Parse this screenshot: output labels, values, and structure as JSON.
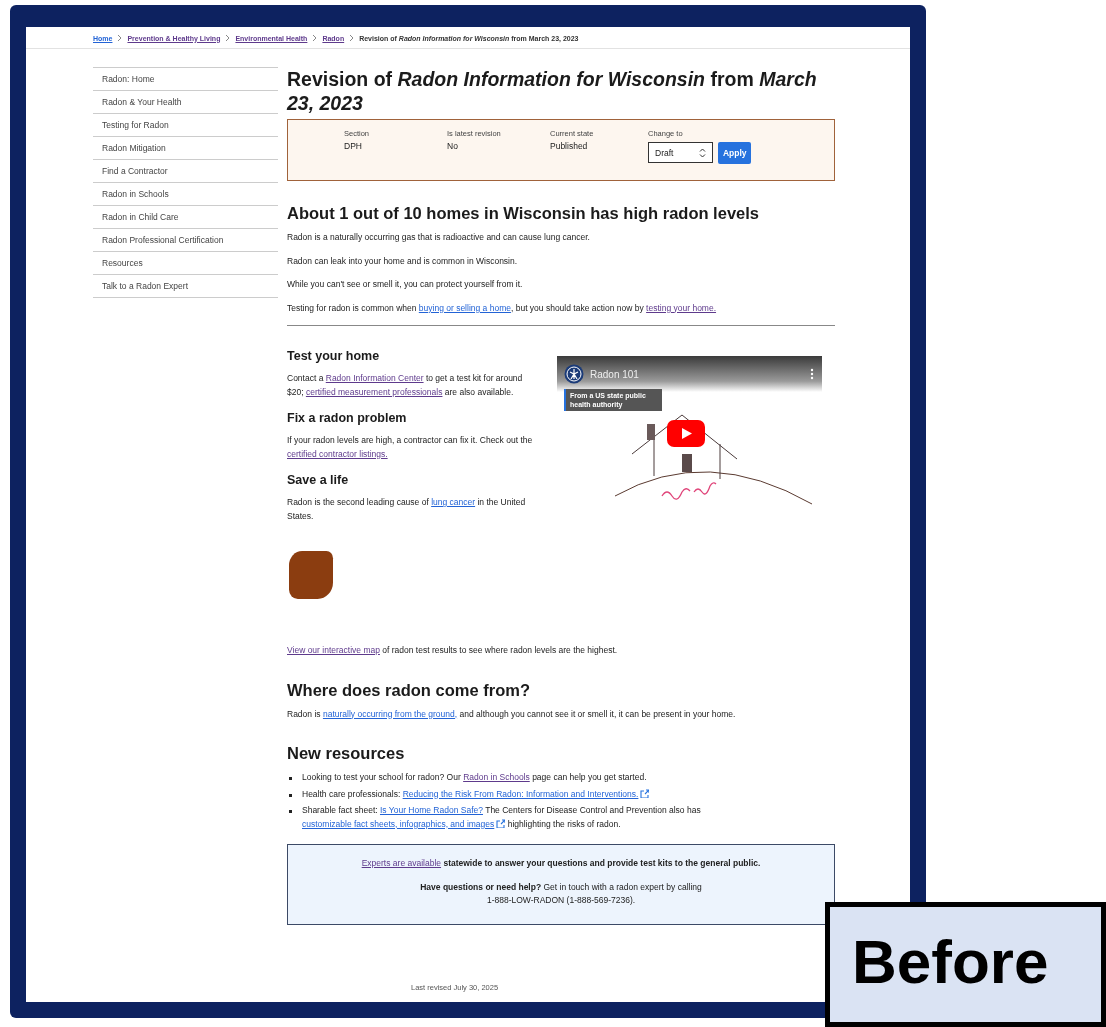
{
  "breadcrumb": {
    "links": [
      {
        "label": "Home",
        "visited": false
      },
      {
        "label": "Prevention & Healthy Living",
        "visited": true
      },
      {
        "label": "Environmental Health",
        "visited": true
      },
      {
        "label": "Radon",
        "visited": true
      }
    ],
    "current": "Revision of *Radon Information for Wisconsin* from March 23, 2023"
  },
  "sidebar": {
    "items": [
      {
        "label": "Radon: Home"
      },
      {
        "label": "Radon & Your Health"
      },
      {
        "label": "Testing for Radon"
      },
      {
        "label": "Radon Mitigation"
      },
      {
        "label": "Find a Contractor"
      },
      {
        "label": "Radon in Schools"
      },
      {
        "label": "Radon in Child Care"
      },
      {
        "label": "Radon Professional Certification"
      },
      {
        "label": "Resources"
      },
      {
        "label": "Talk to a Radon Expert"
      }
    ]
  },
  "title": "Revision of *Radon Information for Wisconsin* from *March 23, 2023*",
  "revision": {
    "fields": [
      {
        "label": "Section",
        "value": "DPH"
      },
      {
        "label": "Is latest revision",
        "value": "No"
      },
      {
        "label": "Current state",
        "value": "Published"
      }
    ],
    "change_to": {
      "label": "Change to",
      "value": "Draft"
    },
    "apply_button": "Apply"
  },
  "intro": {
    "heading": "About 1 out of 10 homes in Wisconsin has high radon levels",
    "paragraphs": [
      [
        {
          "kind": "text",
          "text": "Radon is a naturally occurring gas that is radioactive and can cause lung cancer."
        }
      ],
      [
        {
          "kind": "text",
          "text": "Radon can leak into your home and is common in Wisconsin."
        }
      ],
      [
        {
          "kind": "text",
          "text": "While you can't see or smell it, you can protect yourself from it."
        }
      ],
      [
        {
          "kind": "text",
          "text": "Testing for radon is common when "
        },
        {
          "kind": "link",
          "text": "buying or selling a home",
          "visited": false,
          "external": false
        },
        {
          "kind": "text",
          "text": ", but you should take action now by "
        },
        {
          "kind": "link",
          "text": "testing your home.",
          "visited": true,
          "external": false
        }
      ]
    ]
  },
  "features": {
    "sections": [
      {
        "heading": "Test your home",
        "paragraph": [
          {
            "kind": "text",
            "text": "Contact a "
          },
          {
            "kind": "link",
            "text": "Radon Information Center",
            "visited": true,
            "external": false
          },
          {
            "kind": "text",
            "text": " to get a test kit for around $20; "
          },
          {
            "kind": "link",
            "text": "certified measurement professionals",
            "visited": true,
            "external": false
          },
          {
            "kind": "text",
            "text": " are also available."
          }
        ]
      },
      {
        "heading": "Fix a radon problem",
        "paragraph": [
          {
            "kind": "text",
            "text": "If your radon levels are high, a contractor can fix it. Check out the "
          },
          {
            "kind": "link",
            "text": "certified contractor listings.",
            "visited": true,
            "external": false
          }
        ]
      },
      {
        "heading": "Save a life",
        "paragraph": [
          {
            "kind": "text",
            "text": "Radon is the second leading cause of "
          },
          {
            "kind": "link",
            "text": "lung cancer",
            "visited": false,
            "external": false
          },
          {
            "kind": "text",
            "text": " in the United States."
          }
        ]
      }
    ],
    "video": {
      "title": "Radon 101",
      "info_badge": "From a US state public health authority"
    }
  },
  "map_note": [
    {
      "kind": "link",
      "text": "View our interactive map",
      "visited": true,
      "external": false
    },
    {
      "kind": "text",
      "text": " of radon test results to see where radon levels are the highest."
    }
  ],
  "origin": {
    "heading": "Where does radon come from?",
    "paragraph": [
      {
        "kind": "text",
        "text": "Radon is "
      },
      {
        "kind": "link",
        "text": "naturally occurring from the ground,",
        "visited": false,
        "external": false
      },
      {
        "kind": "text",
        "text": " and although you cannot see it or smell it, it can be present in your home."
      }
    ]
  },
  "resources": {
    "heading": "New resources",
    "items": [
      [
        {
          "kind": "text",
          "text": "Looking to test your school for radon? Our "
        },
        {
          "kind": "link",
          "text": "Radon in Schools",
          "visited": true,
          "external": false
        },
        {
          "kind": "text",
          "text": " page can help you get started."
        }
      ],
      [
        {
          "kind": "text",
          "text": "Health care professionals: "
        },
        {
          "kind": "link",
          "text": "Reducing the Risk From Radon: Information and Interventions.",
          "visited": false,
          "external": true
        }
      ],
      [
        {
          "kind": "text",
          "text": "Sharable fact sheet: "
        },
        {
          "kind": "link",
          "text": "Is Your Home Radon Safe?",
          "visited": false,
          "external": false
        },
        {
          "kind": "text",
          "text": " The Centers for Disease Control and Prevention also has "
        },
        {
          "kind": "link",
          "text": "customizable fact sheets, infographics, and images",
          "visited": false,
          "external": true
        },
        {
          "kind": "text",
          "text": " highlighting the risks of radon."
        }
      ]
    ]
  },
  "callout": {
    "paragraphs": [
      [
        {
          "kind": "link",
          "text": "Experts are available",
          "visited": true,
          "external": false
        },
        {
          "kind": "bold",
          "text": " statewide to answer your questions and provide test kits to the general public."
        }
      ],
      [
        {
          "kind": "bold",
          "text": "Have questions or need help?"
        },
        {
          "kind": "text",
          "text": " Get in touch with a radon expert by calling "
        },
        {
          "kind": "text",
          "text": "1-888-LOW-RADON (1-888-569-7236)."
        }
      ]
    ]
  },
  "footer": "Last revised July 30, 2025",
  "label": "Before"
}
